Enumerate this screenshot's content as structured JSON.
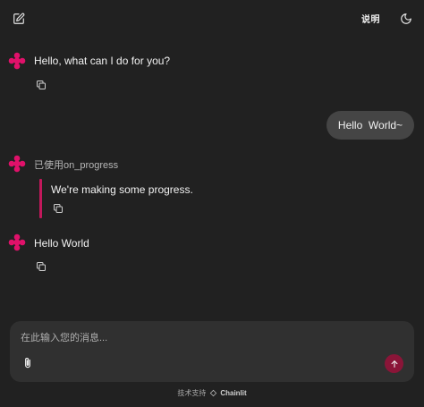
{
  "header": {
    "readme_label": "说明"
  },
  "messages": {
    "assistant_1": "Hello, what can I do for you?",
    "user_1": "Hello  World~",
    "step_label": "已使用on_progress",
    "step_output": "We're making some progress.",
    "assistant_2": "Hello World"
  },
  "composer": {
    "placeholder": "在此输入您的消息..."
  },
  "footer": {
    "built_with": "技术支持",
    "brand": "Chainlit"
  },
  "colors": {
    "background": "#212121",
    "accent": "#c2185b",
    "send_button": "#8a1538",
    "user_bubble": "#454545"
  }
}
